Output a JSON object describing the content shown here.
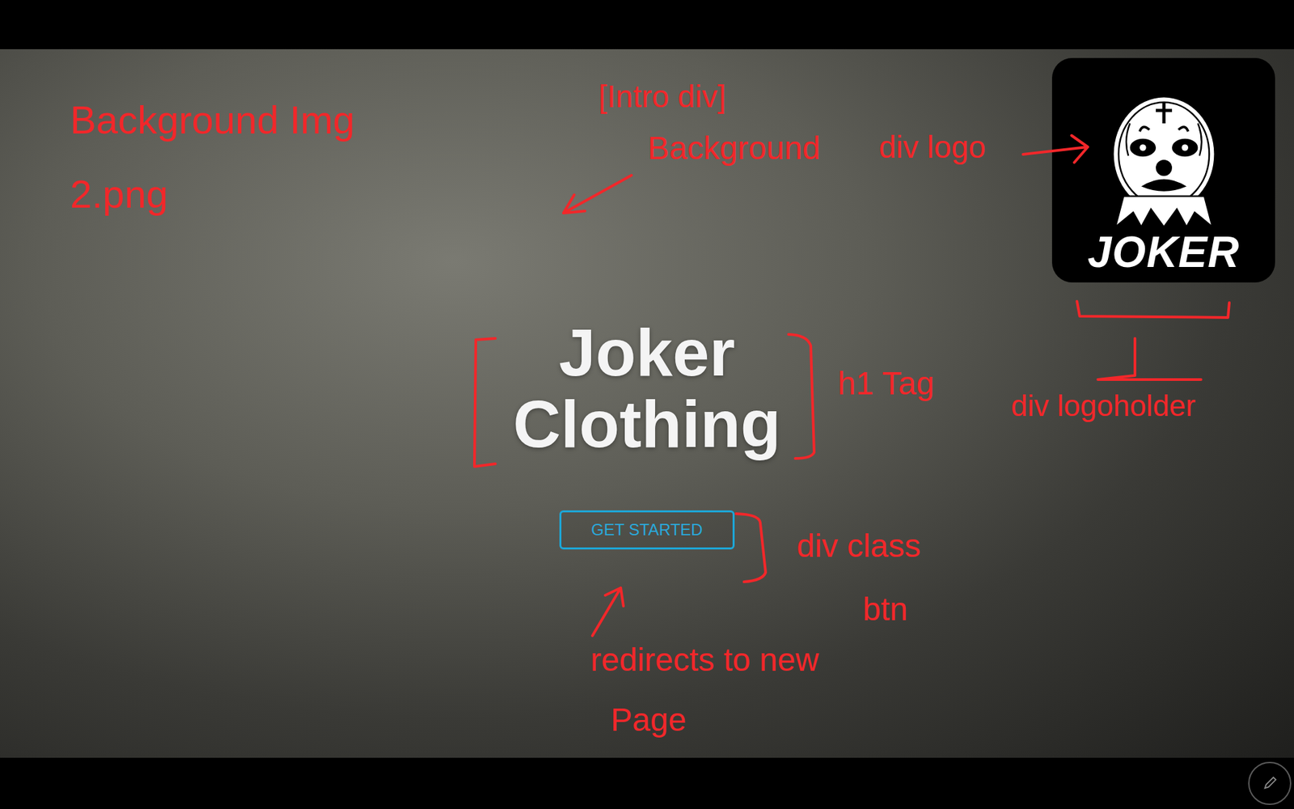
{
  "logo": {
    "text": "JOKER"
  },
  "hero": {
    "title_lines": [
      "Joker",
      "Clothing"
    ],
    "button": "GET STARTED"
  },
  "annotations": {
    "background_img": [
      "Background Img",
      "2.png"
    ],
    "intro_div": "[Intro div]",
    "background": "Background",
    "div_logo": "div logo",
    "h1_tag": "h1 Tag",
    "logoholder": "div logoholder",
    "btn": [
      "div class",
      "btn"
    ],
    "redirect": [
      "redirects to new",
      "Page"
    ]
  }
}
